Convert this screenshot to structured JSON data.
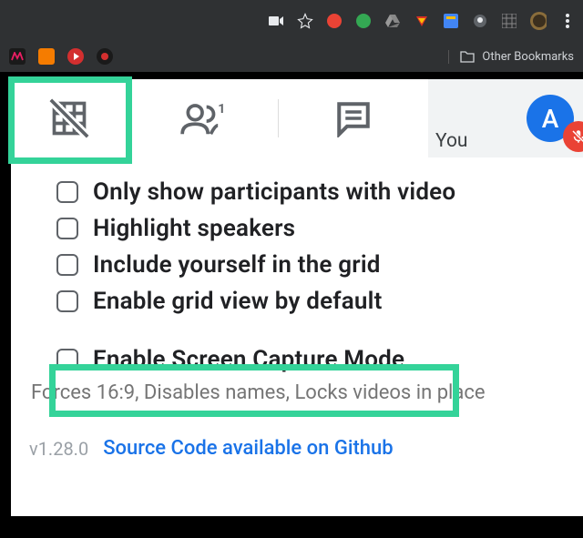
{
  "browser": {
    "other_bookmarks": "Other Bookmarks"
  },
  "self_tile": {
    "label": "You",
    "avatar_initial": "A"
  },
  "options": [
    {
      "label": "Only show participants with video"
    },
    {
      "label": "Highlight speakers"
    },
    {
      "label": "Include yourself in the grid"
    },
    {
      "label": "Enable grid view by default"
    }
  ],
  "screen_capture": {
    "label": "Enable Screen Capture Mode",
    "desc": "Forces 16:9, Disables names, Locks videos in place"
  },
  "footer": {
    "version": "v1.28.0",
    "link": "Source Code available on Github"
  }
}
